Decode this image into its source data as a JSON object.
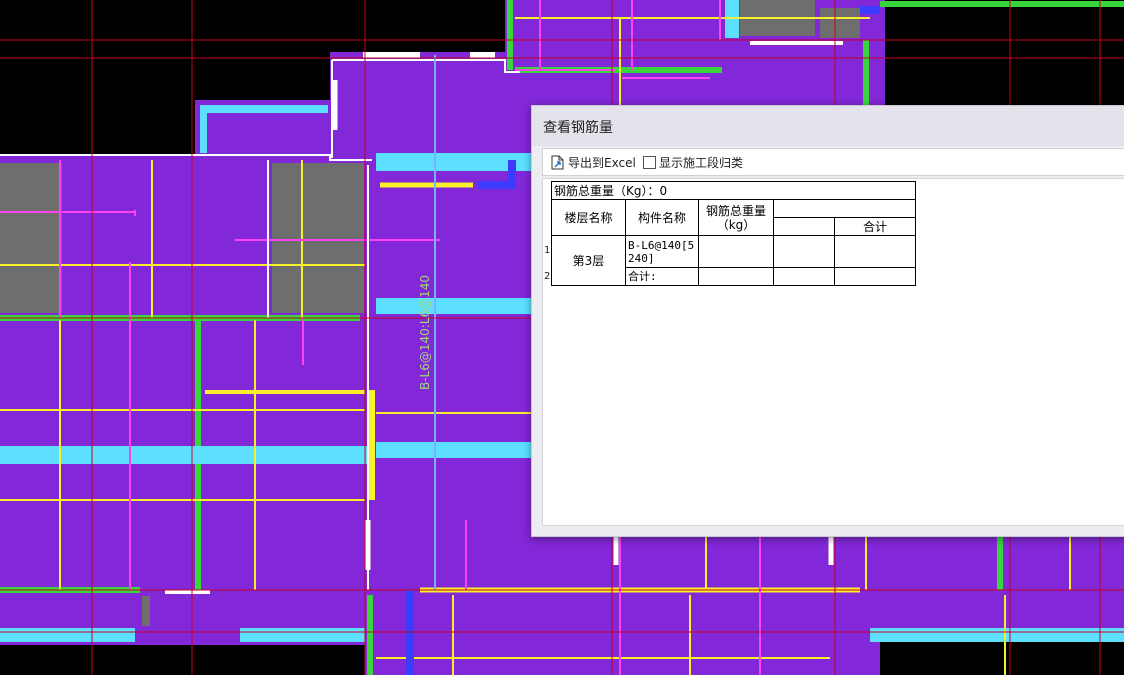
{
  "drawing": {
    "annotation": "B-L6@140:L6@140",
    "colors": {
      "background": "#000000",
      "slab": "#8228d8",
      "wall": "#5de0ff",
      "beam_yellow": "#f7f02a",
      "beam_magenta": "#ff42f0",
      "column_gray": "#6e6e6e",
      "green": "#38d63a",
      "blue": "#3c3cff",
      "grid_red": "#c8001e"
    }
  },
  "dialog": {
    "title": "查看钢筋量",
    "toolbar": {
      "export_label": "导出到Excel",
      "export_icon": "excel-export-icon",
      "checkbox_label": "显示施工段归类",
      "checkbox_checked": false
    },
    "table": {
      "total_weight_label": "钢筋总重量（Kg）：0",
      "headers": {
        "floor": "楼层名称",
        "component": "构件名称",
        "total_weight": "钢筋总重量（kg）",
        "empty": "",
        "sum": "合计"
      },
      "row_numbers": [
        "1",
        "2"
      ],
      "rows": [
        {
          "floor": "第3层",
          "component": "B-L6@140[5240]",
          "weight": "",
          "c4": "",
          "c5": ""
        },
        {
          "component": "合计:",
          "weight": "",
          "c4": "",
          "c5": ""
        }
      ]
    }
  }
}
